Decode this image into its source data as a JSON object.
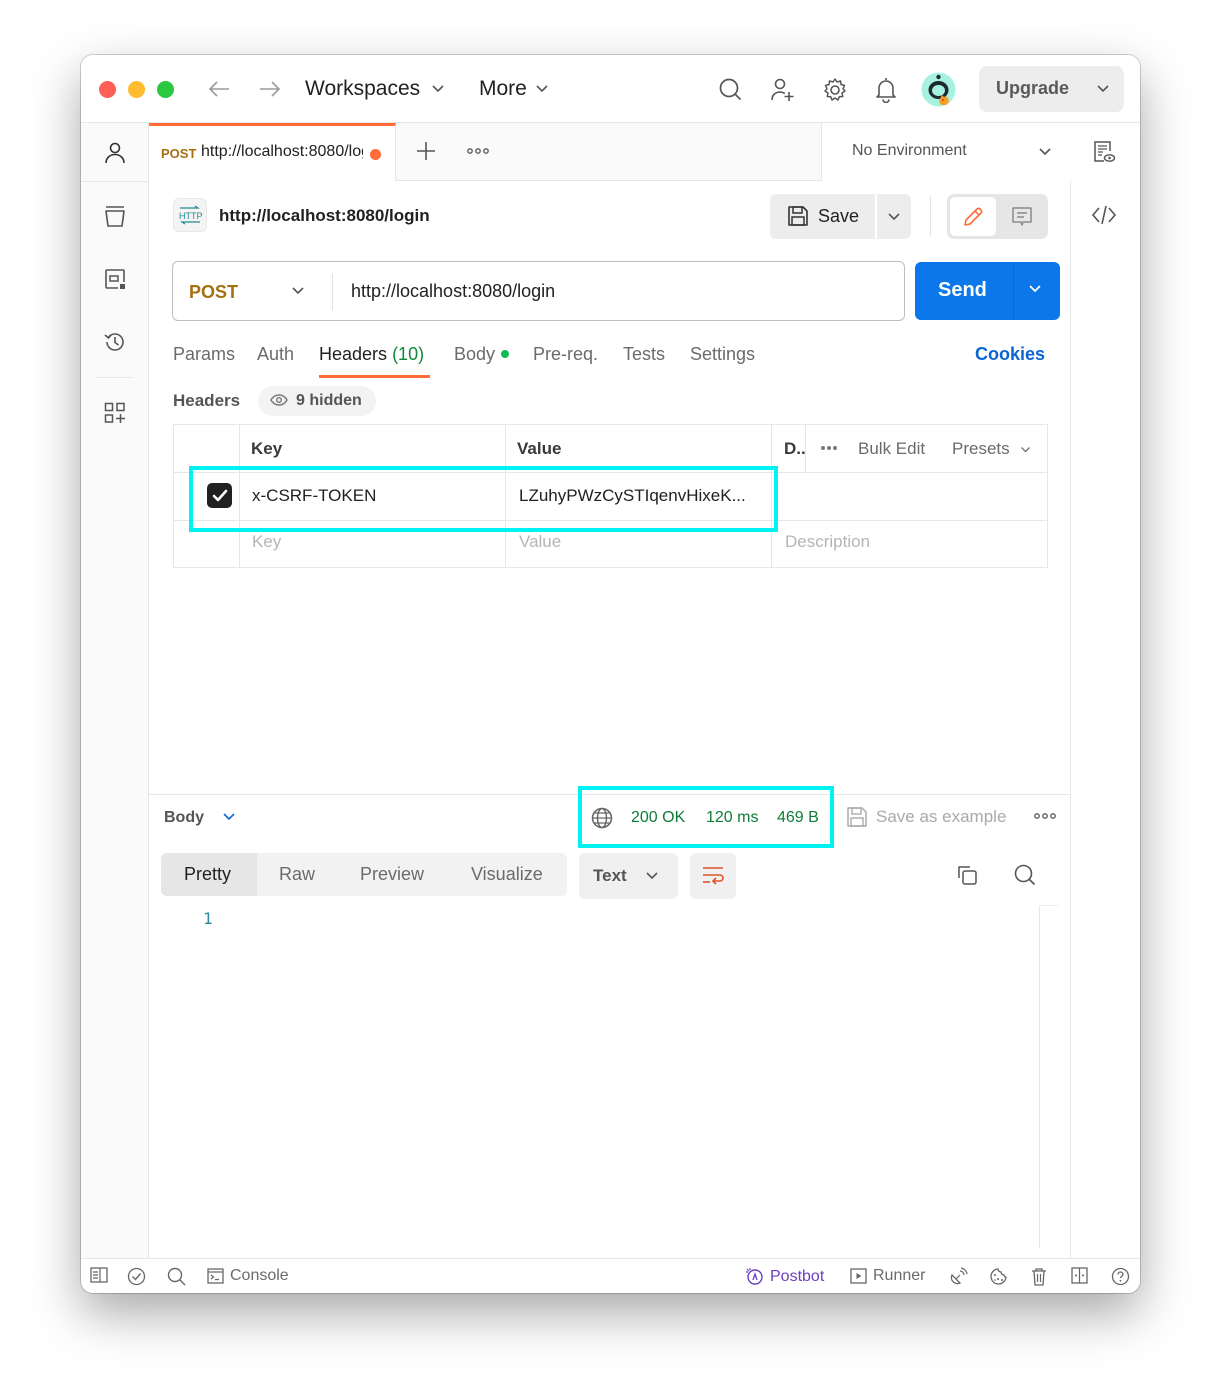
{
  "titlebar": {
    "workspaces_label": "Workspaces",
    "more_label": "More",
    "upgrade_label": "Upgrade"
  },
  "tab": {
    "method": "POST",
    "url": "http://localhost:8080/login",
    "unsaved": true
  },
  "environment": {
    "selected": "No Environment"
  },
  "request": {
    "title": "http://localhost:8080/login",
    "save_label": "Save",
    "method": "POST",
    "url": "http://localhost:8080/login",
    "send_label": "Send",
    "tabs": [
      {
        "label": "Params"
      },
      {
        "label": "Auth"
      },
      {
        "label": "Headers",
        "count": "(10)",
        "active": true
      },
      {
        "label": "Body",
        "indicator": true
      },
      {
        "label": "Pre-req."
      },
      {
        "label": "Tests"
      },
      {
        "label": "Settings"
      }
    ],
    "cookies_label": "Cookies"
  },
  "headers": {
    "label": "Headers",
    "hidden_label": "9 hidden",
    "columns": {
      "key": "Key",
      "value": "Value",
      "description": "D.."
    },
    "bulk_edit_label": "Bulk Edit",
    "presets_label": "Presets",
    "rows": [
      {
        "checked": true,
        "key": "x-CSRF-TOKEN",
        "value": "LZuhyPWzCySTIqenvHixeK...",
        "description": ""
      }
    ],
    "placeholder": {
      "key": "Key",
      "value": "Value",
      "description": "Description"
    }
  },
  "response": {
    "section_label": "Body",
    "status": "200 OK",
    "time": "120 ms",
    "size": "469 B",
    "save_example_label": "Save as example",
    "views": [
      {
        "label": "Pretty",
        "active": true
      },
      {
        "label": "Raw"
      },
      {
        "label": "Preview"
      },
      {
        "label": "Visualize"
      }
    ],
    "format": "Text",
    "line_numbers": [
      "1"
    ]
  },
  "footer": {
    "console_label": "Console",
    "postbot_label": "Postbot",
    "runner_label": "Runner"
  },
  "colors": {
    "accent": "#ff6c37",
    "send": "#0c77ea",
    "method_post": "#a7700f",
    "status_ok": "#0f7d36",
    "highlight": "#00f2f2",
    "postbot": "#6b3fbd"
  }
}
